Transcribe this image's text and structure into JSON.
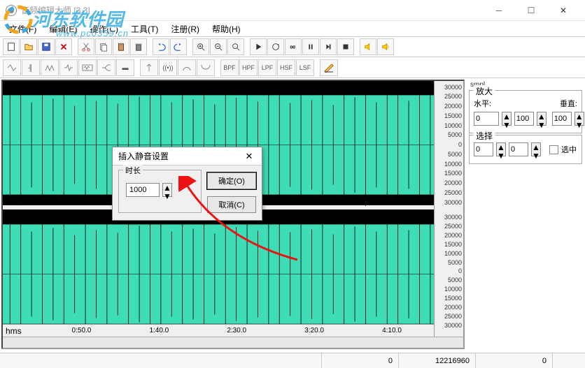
{
  "window": {
    "title": "音频编辑大师 [3.3]"
  },
  "menu": {
    "file": "文件(F)",
    "edit": "编辑(E)",
    "operate": "操作(C)",
    "tool": "工具(T)",
    "register": "注册(R)",
    "help": "帮助(H)"
  },
  "filters": {
    "bpf": "BPF",
    "hpf": "HPF",
    "lpf": "LPF",
    "hsf": "HSF",
    "lsf": "LSF"
  },
  "side": {
    "smpl": "smpl",
    "zoom_group": "放大",
    "horizontal": "水平:",
    "vertical": "垂直:",
    "h_val": "0",
    "h_max": "100",
    "v_val": "100",
    "select_group": "选择",
    "sel_start": "0",
    "sel_end": "0",
    "sel_checkbox": "选中"
  },
  "ruler": {
    "top": [
      "30000",
      "25000",
      "20000",
      "15000",
      "10000",
      "5000",
      "0",
      "5000",
      "10000",
      "15000",
      "20000",
      "25000",
      "30000"
    ],
    "bot": [
      "30000",
      "25000",
      "20000",
      "15000",
      "10000",
      "5000",
      "0",
      "5000",
      "10000",
      "15000",
      "20000",
      "25000",
      "30000"
    ]
  },
  "time": {
    "label": "hms",
    "ticks": [
      "0:50.0",
      "1:40.0",
      "2:30.0",
      "3:20.0",
      "4:10.0"
    ]
  },
  "dialog": {
    "title": "插入静音设置",
    "duration_label": "时长",
    "duration_value": "1000",
    "ok": "确定(O)",
    "cancel": "取消(C)"
  },
  "status": {
    "pos1": "0",
    "pos2": "12216960",
    "pos3": "0"
  },
  "watermark": {
    "site_name": "河东软件园",
    "url": "www.pc0359.cn"
  }
}
